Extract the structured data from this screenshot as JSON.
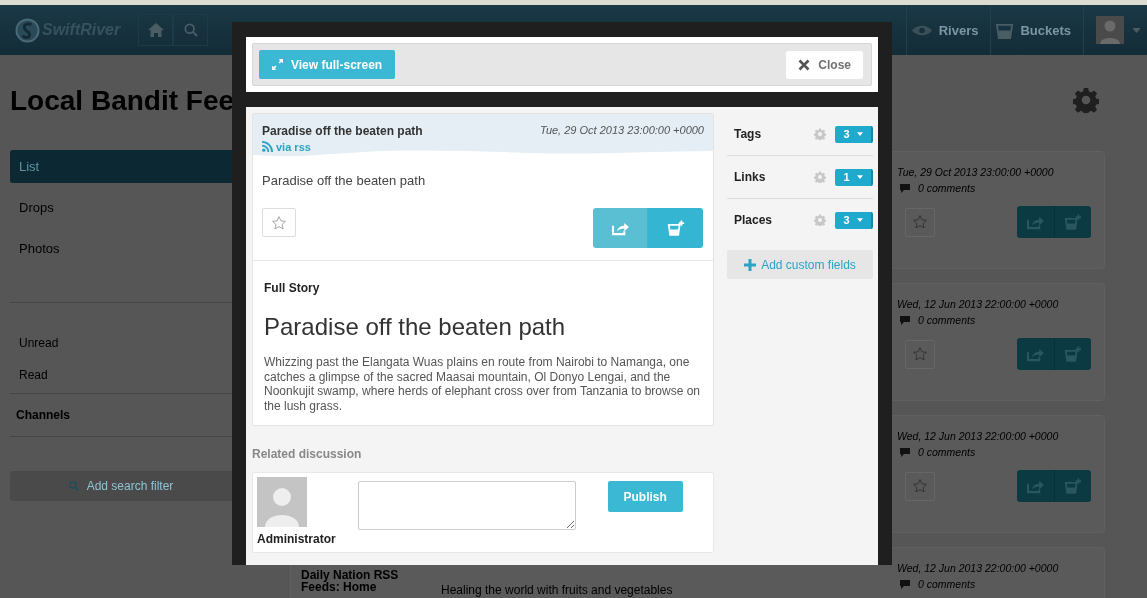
{
  "header": {
    "logo": "SwiftRiver",
    "nav": [
      {
        "label": "Rivers",
        "kind": "rivers"
      },
      {
        "label": "Buckets",
        "kind": "buckets"
      }
    ]
  },
  "page": {
    "title": "Local Bandit Fee"
  },
  "sidebar": {
    "views": [
      {
        "label": "List",
        "selected": true
      },
      {
        "label": "Drops",
        "selected": false
      },
      {
        "label": "Photos",
        "selected": false
      }
    ],
    "filters": [
      {
        "label": "Unread"
      },
      {
        "label": "Read"
      }
    ],
    "channels_heading": "Channels",
    "add_filter": "Add search filter"
  },
  "drops": [
    {
      "date": "Tue, 29 Oct 2013 23:00:00 +0000",
      "comments": "0 comments"
    },
    {
      "date": "Wed, 12 Jun 2013 22:00:00 +0000",
      "comments": "0 comments"
    },
    {
      "date": "Wed, 12 Jun 2013 22:00:00 +0000",
      "comments": "0 comments"
    },
    {
      "title": "Daily Nation RSS Feeds: Home",
      "text": "Healing the world with fruits and vegetables",
      "date": "Wed, 12 Jun 2013 22:00:00 +0000",
      "comments": "0 comments"
    }
  ],
  "modal": {
    "fullscreen_button": "View full-screen",
    "close_button": "Close",
    "drop": {
      "title": "Paradise off the beaten path",
      "source": "via rss",
      "date": "Tue, 29 Oct 2013 23:00:00 +0000",
      "text": "Paradise off the beaten path",
      "starred": false,
      "full_story_label": "Full Story",
      "headline": "Paradise off the beaten path",
      "body": "Whizzing past the Elangata Wuas plains en route from Nairobi to Namanga, one catches a glimpse of the sacred Maasai mountain, Ol Donyo Lengai, and the Noonkujit swamp, where herds of elephant cross over from Tanzania to browse on the lush grass."
    },
    "meta": [
      {
        "label": "Tags",
        "count": "3"
      },
      {
        "label": "Links",
        "count": "1"
      },
      {
        "label": "Places",
        "count": "3"
      }
    ],
    "add_custom_fields": "Add custom fields",
    "discussion": {
      "heading": "Related discussion",
      "author": "Administrator",
      "publish_button": "Publish"
    }
  }
}
